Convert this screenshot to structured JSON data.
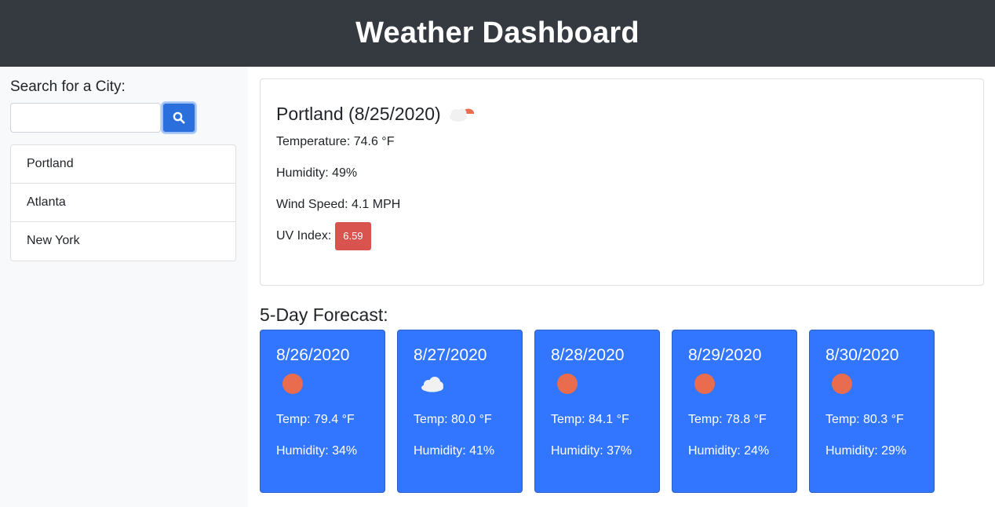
{
  "header": {
    "title": "Weather Dashboard"
  },
  "sidebar": {
    "search_label": "Search for a City:",
    "search_value": "",
    "search_placeholder": "",
    "search_button_icon": "search-icon",
    "cities": [
      "Portland",
      "Atlanta",
      "New York"
    ]
  },
  "current": {
    "title": "Portland (8/25/2020)",
    "icon": "partly-cloudy-sun-icon",
    "temperature": "Temperature: 74.6 °F",
    "humidity": "Humidity: 49%",
    "wind": "Wind Speed: 4.1 MPH",
    "uv_label": "UV Index:",
    "uv_value": "6.59"
  },
  "forecast": {
    "title": "5-Day Forecast:",
    "days": [
      {
        "date": "8/26/2020",
        "icon": "sun-icon",
        "temp": "Temp: 79.4 °F",
        "humidity": "Humidity: 34%"
      },
      {
        "date": "8/27/2020",
        "icon": "cloud-icon",
        "temp": "Temp: 80.0 °F",
        "humidity": "Humidity: 41%"
      },
      {
        "date": "8/28/2020",
        "icon": "sun-icon",
        "temp": "Temp: 84.1 °F",
        "humidity": "Humidity: 37%"
      },
      {
        "date": "8/29/2020",
        "icon": "sun-icon",
        "temp": "Temp: 78.8 °F",
        "humidity": "Humidity: 24%"
      },
      {
        "date": "8/30/2020",
        "icon": "sun-icon",
        "temp": "Temp: 80.3 °F",
        "humidity": "Humidity: 29%"
      }
    ]
  },
  "colors": {
    "header_bg": "#343a40",
    "search_button": "#2a6fdb",
    "uv_badge": "#d9534f",
    "forecast_card": "#3276ff",
    "sun": "#e86c4d"
  }
}
